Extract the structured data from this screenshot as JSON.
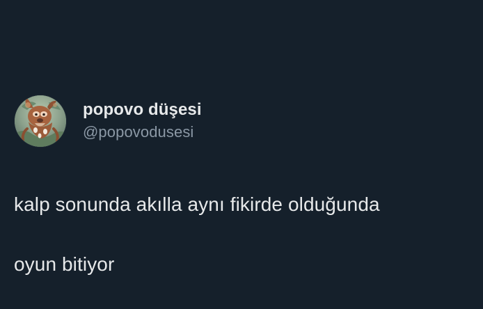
{
  "tweet": {
    "author": {
      "display_name": "popovo düşesi",
      "handle": "@popovodusesi",
      "avatar_icon": "deer-avatar-icon"
    },
    "text_line_1": "kalp sonunda akılla aynı fikirde olduğunda",
    "text_line_2": "oyun bitiyor"
  },
  "colors": {
    "background": "#15202b",
    "primary_text": "#e7e9ea",
    "secondary_text": "#8b98a5"
  }
}
